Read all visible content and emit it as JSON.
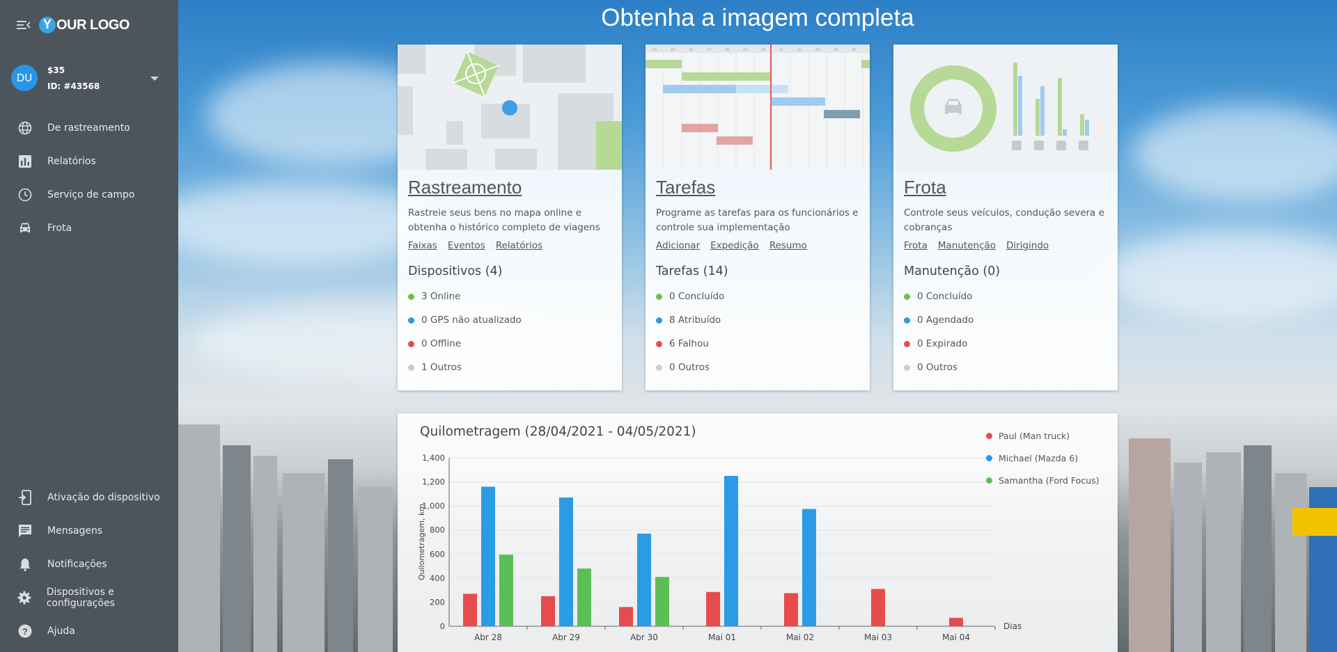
{
  "logo": {
    "mark": "Y",
    "text": "OUR LOGO"
  },
  "account": {
    "initials": "DU",
    "balance": "$35",
    "id": "ID: #43568"
  },
  "nav_top": [
    {
      "label": "De rastreamento",
      "icon": "globe-icon"
    },
    {
      "label": "Relatórios",
      "icon": "bar-chart-icon"
    },
    {
      "label": "Serviço de campo",
      "icon": "clock-pin-icon"
    },
    {
      "label": "Frota",
      "icon": "car-icon"
    }
  ],
  "nav_bottom": [
    {
      "label": "Ativação do dispositivo",
      "icon": "device-activation-icon"
    },
    {
      "label": "Mensagens",
      "icon": "message-icon"
    },
    {
      "label": "Notificações",
      "icon": "bell-icon"
    },
    {
      "label": "Dispositivos e configurações",
      "icon": "gear-icon"
    },
    {
      "label": "Ajuda",
      "icon": "help-icon"
    }
  ],
  "headline": "Obtenha a imagem completa",
  "cards": [
    {
      "title": "Rastreamento",
      "description": "Rastreie seus bens no mapa online e obtenha o histórico completo de viagens",
      "links": [
        "Faixas",
        "Eventos",
        "Relatórios"
      ],
      "subtitle": "Dispositivos (4)",
      "stats": [
        {
          "text": "3 Online",
          "color": "#6cc04a"
        },
        {
          "text": "0 GPS não atualizado",
          "color": "#2b9be6"
        },
        {
          "text": "0 Offline",
          "color": "#e74c4c"
        },
        {
          "text": "1 Outros",
          "color": "#cccccc"
        }
      ]
    },
    {
      "title": "Tarefas",
      "description": "Programe as tarefas para os funcionários e controle sua implementação",
      "links": [
        "Adicionar",
        "Expedição",
        "Resumo"
      ],
      "subtitle": "Tarefas (14)",
      "stats": [
        {
          "text": "0 Concluído",
          "color": "#6cc04a"
        },
        {
          "text": "8 Atribuído",
          "color": "#2b9be6"
        },
        {
          "text": "6 Falhou",
          "color": "#e74c4c"
        },
        {
          "text": "0 Outros",
          "color": "#cccccc"
        }
      ]
    },
    {
      "title": "Frota",
      "description": "Controle seus veículos, condução severa e cobranças",
      "links": [
        "Frota",
        "Manutenção",
        "Dirigindo"
      ],
      "subtitle": "Manutenção (0)",
      "stats": [
        {
          "text": "0 Concluído",
          "color": "#6cc04a"
        },
        {
          "text": "0 Agendado",
          "color": "#2b9be6"
        },
        {
          "text": "0 Expirado",
          "color": "#e74c4c"
        },
        {
          "text": "0 Outros",
          "color": "#cccccc"
        }
      ]
    }
  ],
  "gantt_days": [
    "14",
    "15",
    "16",
    "17",
    "18",
    "19",
    "20",
    "21",
    "22",
    "23",
    "24",
    "25"
  ],
  "chart_data": {
    "type": "bar",
    "title": "Quilometragem (28/04/2021 - 04/05/2021)",
    "xlabel": "Dias",
    "ylabel": "Quilometragem, km",
    "ylim": [
      0,
      1400
    ],
    "yticks": [
      "0",
      "200",
      "400",
      "600",
      "800",
      "1,000",
      "1,200",
      "1,400"
    ],
    "categories": [
      "Abr 28",
      "Abr 29",
      "Abr 30",
      "Mai 01",
      "Mai 02",
      "Mai 03",
      "Mai 04"
    ],
    "grid": true,
    "legend": "top-right",
    "series": [
      {
        "name": "Paul (Man truck)",
        "color": "#e74c4c",
        "values": [
          270,
          250,
          160,
          285,
          275,
          310,
          70
        ]
      },
      {
        "name": "Michael (Mazda 6)",
        "color": "#2b9be6",
        "values": [
          1160,
          1070,
          770,
          1250,
          975,
          0,
          0
        ]
      },
      {
        "name": "Samantha (Ford Focus)",
        "color": "#5cbf55",
        "values": [
          595,
          480,
          410,
          0,
          0,
          0,
          0
        ]
      }
    ]
  }
}
